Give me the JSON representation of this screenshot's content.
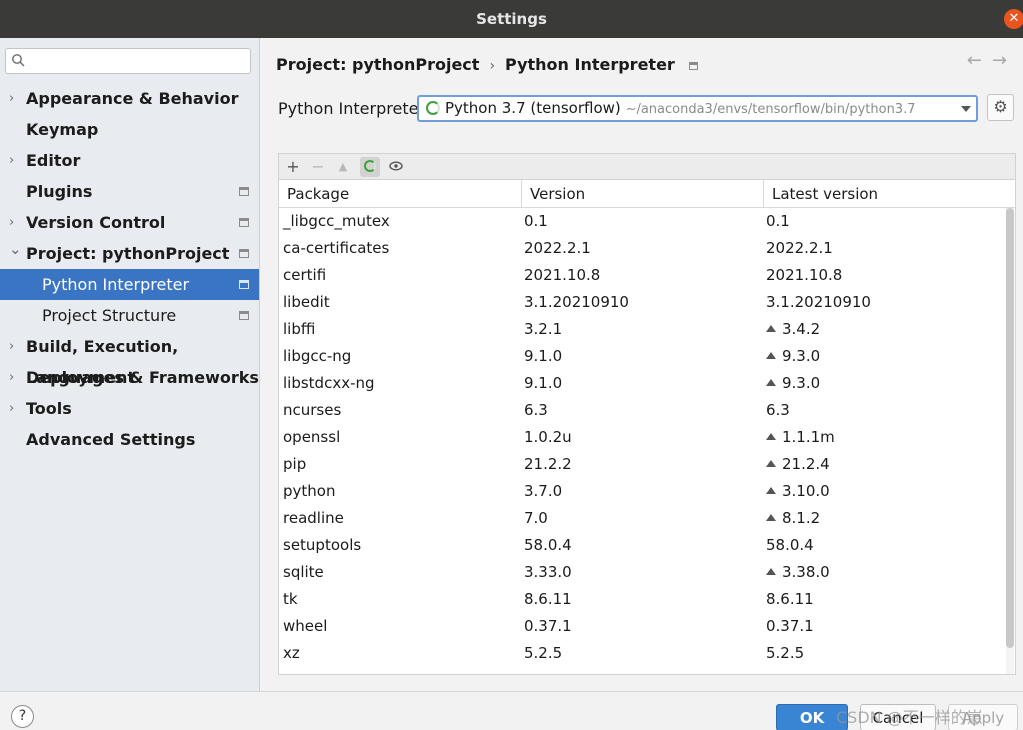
{
  "window": {
    "title": "Settings"
  },
  "sidebar": {
    "search_placeholder": "",
    "items": [
      {
        "label": "Appearance & Behavior",
        "expandable": true,
        "expanded": false,
        "pinned": false,
        "selected": false,
        "level": 0
      },
      {
        "label": "Keymap",
        "expandable": false,
        "expanded": false,
        "pinned": false,
        "selected": false,
        "level": 0
      },
      {
        "label": "Editor",
        "expandable": true,
        "expanded": false,
        "pinned": false,
        "selected": false,
        "level": 0
      },
      {
        "label": "Plugins",
        "expandable": false,
        "expanded": false,
        "pinned": true,
        "selected": false,
        "level": 0
      },
      {
        "label": "Version Control",
        "expandable": true,
        "expanded": false,
        "pinned": true,
        "selected": false,
        "level": 0
      },
      {
        "label": "Project: pythonProject",
        "expandable": true,
        "expanded": true,
        "pinned": true,
        "selected": false,
        "level": 0
      },
      {
        "label": "Python Interpreter",
        "expandable": false,
        "expanded": false,
        "pinned": true,
        "selected": true,
        "level": 1
      },
      {
        "label": "Project Structure",
        "expandable": false,
        "expanded": false,
        "pinned": true,
        "selected": false,
        "level": 1
      },
      {
        "label": "Build, Execution, Deployment",
        "expandable": true,
        "expanded": false,
        "pinned": false,
        "selected": false,
        "level": 0
      },
      {
        "label": "Languages & Frameworks",
        "expandable": true,
        "expanded": false,
        "pinned": false,
        "selected": false,
        "level": 0
      },
      {
        "label": "Tools",
        "expandable": true,
        "expanded": false,
        "pinned": false,
        "selected": false,
        "level": 0
      },
      {
        "label": "Advanced Settings",
        "expandable": false,
        "expanded": false,
        "pinned": false,
        "selected": false,
        "level": 0
      }
    ]
  },
  "breadcrumb": {
    "project": "Project: pythonProject",
    "page": "Python Interpreter"
  },
  "interpreter": {
    "label": "Python Interpreter:",
    "name": "Python 3.7 (tensorflow)",
    "path": "~/anaconda3/envs/tensorflow/bin/python3.7"
  },
  "table": {
    "columns": [
      "Package",
      "Version",
      "Latest version"
    ],
    "rows": [
      {
        "package": "_libgcc_mutex",
        "version": "0.1",
        "latest": "0.1",
        "upgrade": false
      },
      {
        "package": "ca-certificates",
        "version": "2022.2.1",
        "latest": "2022.2.1",
        "upgrade": false
      },
      {
        "package": "certifi",
        "version": "2021.10.8",
        "latest": "2021.10.8",
        "upgrade": false
      },
      {
        "package": "libedit",
        "version": "3.1.20210910",
        "latest": "3.1.20210910",
        "upgrade": false
      },
      {
        "package": "libffi",
        "version": "3.2.1",
        "latest": "3.4.2",
        "upgrade": true
      },
      {
        "package": "libgcc-ng",
        "version": "9.1.0",
        "latest": "9.3.0",
        "upgrade": true
      },
      {
        "package": "libstdcxx-ng",
        "version": "9.1.0",
        "latest": "9.3.0",
        "upgrade": true
      },
      {
        "package": "ncurses",
        "version": "6.3",
        "latest": "6.3",
        "upgrade": false
      },
      {
        "package": "openssl",
        "version": "1.0.2u",
        "latest": "1.1.1m",
        "upgrade": true
      },
      {
        "package": "pip",
        "version": "21.2.2",
        "latest": "21.2.4",
        "upgrade": true
      },
      {
        "package": "python",
        "version": "3.7.0",
        "latest": "3.10.0",
        "upgrade": true
      },
      {
        "package": "readline",
        "version": "7.0",
        "latest": "8.1.2",
        "upgrade": true
      },
      {
        "package": "setuptools",
        "version": "58.0.4",
        "latest": "58.0.4",
        "upgrade": false
      },
      {
        "package": "sqlite",
        "version": "3.33.0",
        "latest": "3.38.0",
        "upgrade": true
      },
      {
        "package": "tk",
        "version": "8.6.11",
        "latest": "8.6.11",
        "upgrade": false
      },
      {
        "package": "wheel",
        "version": "0.37.1",
        "latest": "0.37.1",
        "upgrade": false
      },
      {
        "package": "xz",
        "version": "5.2.5",
        "latest": "5.2.5",
        "upgrade": false
      }
    ]
  },
  "footer": {
    "help": "?",
    "ok": "OK",
    "cancel": "Cancel",
    "apply": "Apply",
    "watermark": "CSDN @不一样的崽"
  },
  "icons": {
    "close": "close-icon",
    "search": "search-icon",
    "gear": "gear-icon",
    "add": "plus-icon",
    "remove": "minus-icon",
    "upgrade": "upgrade-arrow-icon",
    "loading": "loading-spinner-icon",
    "show": "eye-icon"
  },
  "colors": {
    "accent": "#3a75c4",
    "ok_button": "#3a84d4",
    "spinner": "#3fa13a",
    "close": "#e9541f"
  }
}
